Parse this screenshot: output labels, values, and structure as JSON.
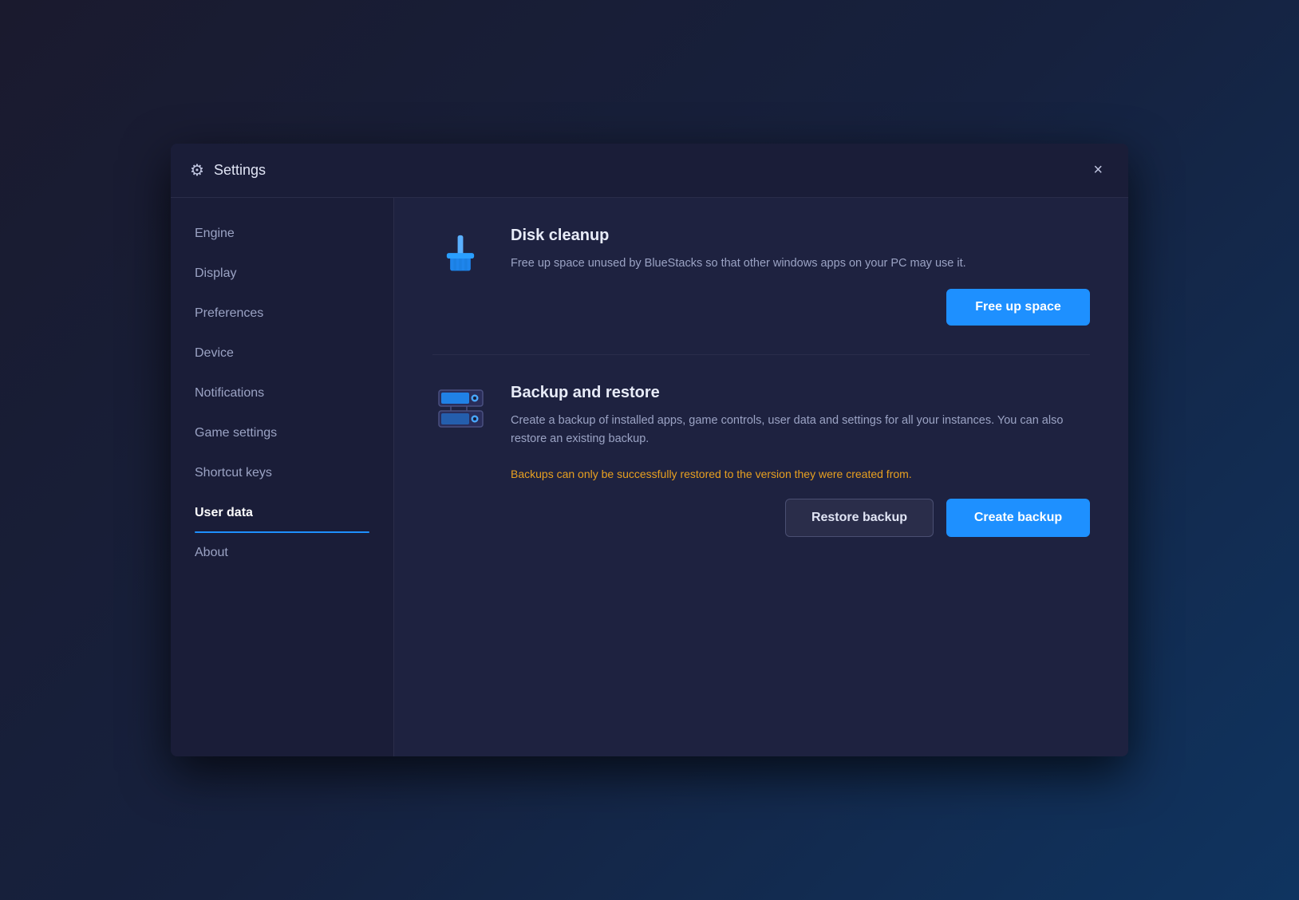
{
  "window": {
    "title": "Settings",
    "close_label": "×"
  },
  "sidebar": {
    "items": [
      {
        "id": "engine",
        "label": "Engine",
        "active": false
      },
      {
        "id": "display",
        "label": "Display",
        "active": false
      },
      {
        "id": "preferences",
        "label": "Preferences",
        "active": false
      },
      {
        "id": "device",
        "label": "Device",
        "active": false
      },
      {
        "id": "notifications",
        "label": "Notifications",
        "active": false
      },
      {
        "id": "game-settings",
        "label": "Game settings",
        "active": false
      },
      {
        "id": "shortcut-keys",
        "label": "Shortcut keys",
        "active": false
      },
      {
        "id": "user-data",
        "label": "User data",
        "active": true
      },
      {
        "id": "about",
        "label": "About",
        "active": false
      }
    ]
  },
  "content": {
    "disk_cleanup": {
      "title": "Disk cleanup",
      "description": "Free up space unused by BlueStacks so that other windows apps on your PC may use it.",
      "button_label": "Free up space"
    },
    "backup_restore": {
      "title": "Backup and restore",
      "description": "Create a backup of installed apps, game controls, user data and settings for all your instances. You can also restore an existing backup.",
      "warning": "Backups can only be successfully restored to the version they were created from.",
      "restore_label": "Restore backup",
      "create_label": "Create backup"
    }
  },
  "colors": {
    "accent_blue": "#1e90ff",
    "warning_orange": "#e8a020",
    "sidebar_bg": "#1a1d38",
    "content_bg": "#1e2240"
  }
}
